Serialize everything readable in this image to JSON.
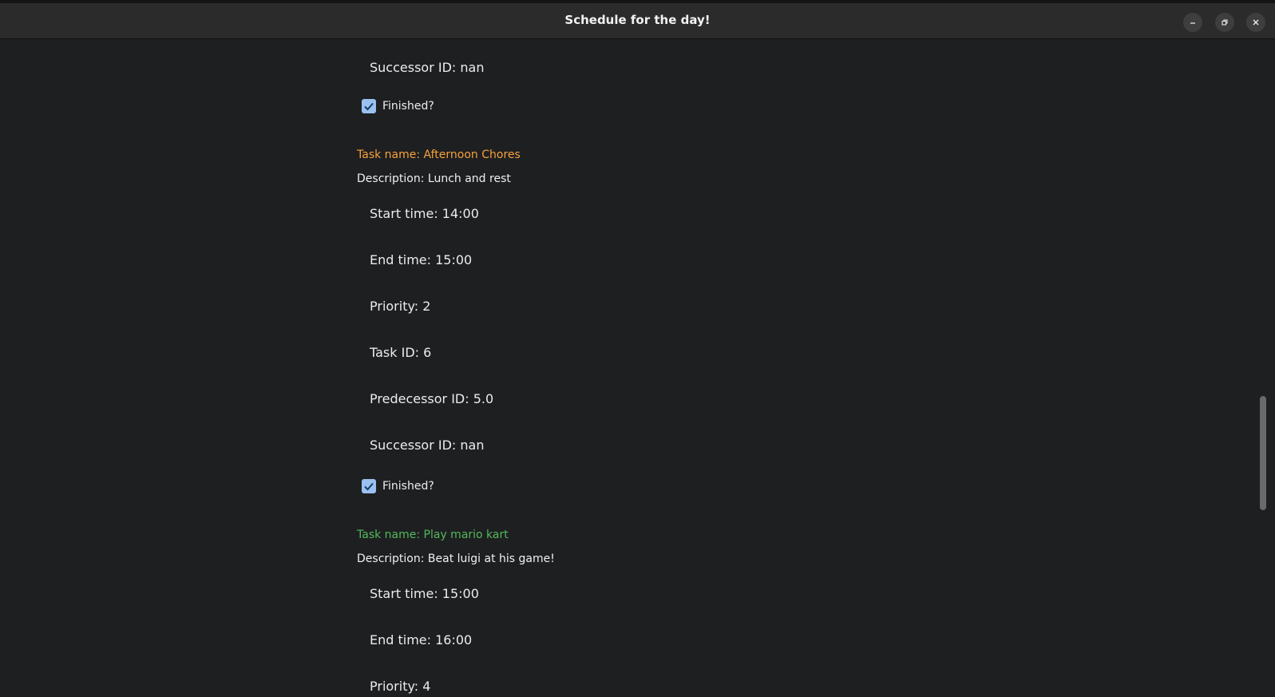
{
  "window": {
    "title": "Schedule for the day!"
  },
  "tasks": [
    {
      "successor": "Successor ID: nan",
      "finished_label": "Finished?",
      "finished": true
    },
    {
      "name": "Task name: Afternoon Chores",
      "name_color": "#f5a23b",
      "description": "Description: Lunch  and rest",
      "start": "Start time: 14:00",
      "end": "End time: 15:00",
      "priority": "Priority: 2",
      "task_id": "Task ID: 6",
      "predecessor": "Predecessor ID: 5.0",
      "successor": "Successor ID: nan",
      "finished_label": "Finished?",
      "finished": true
    },
    {
      "name": "Task name: Play mario kart",
      "name_color": "#52b95a",
      "description": "Description: Beat luigi at his game!",
      "start": "Start time: 15:00",
      "end": "End time: 16:00",
      "priority": "Priority: 4"
    }
  ]
}
